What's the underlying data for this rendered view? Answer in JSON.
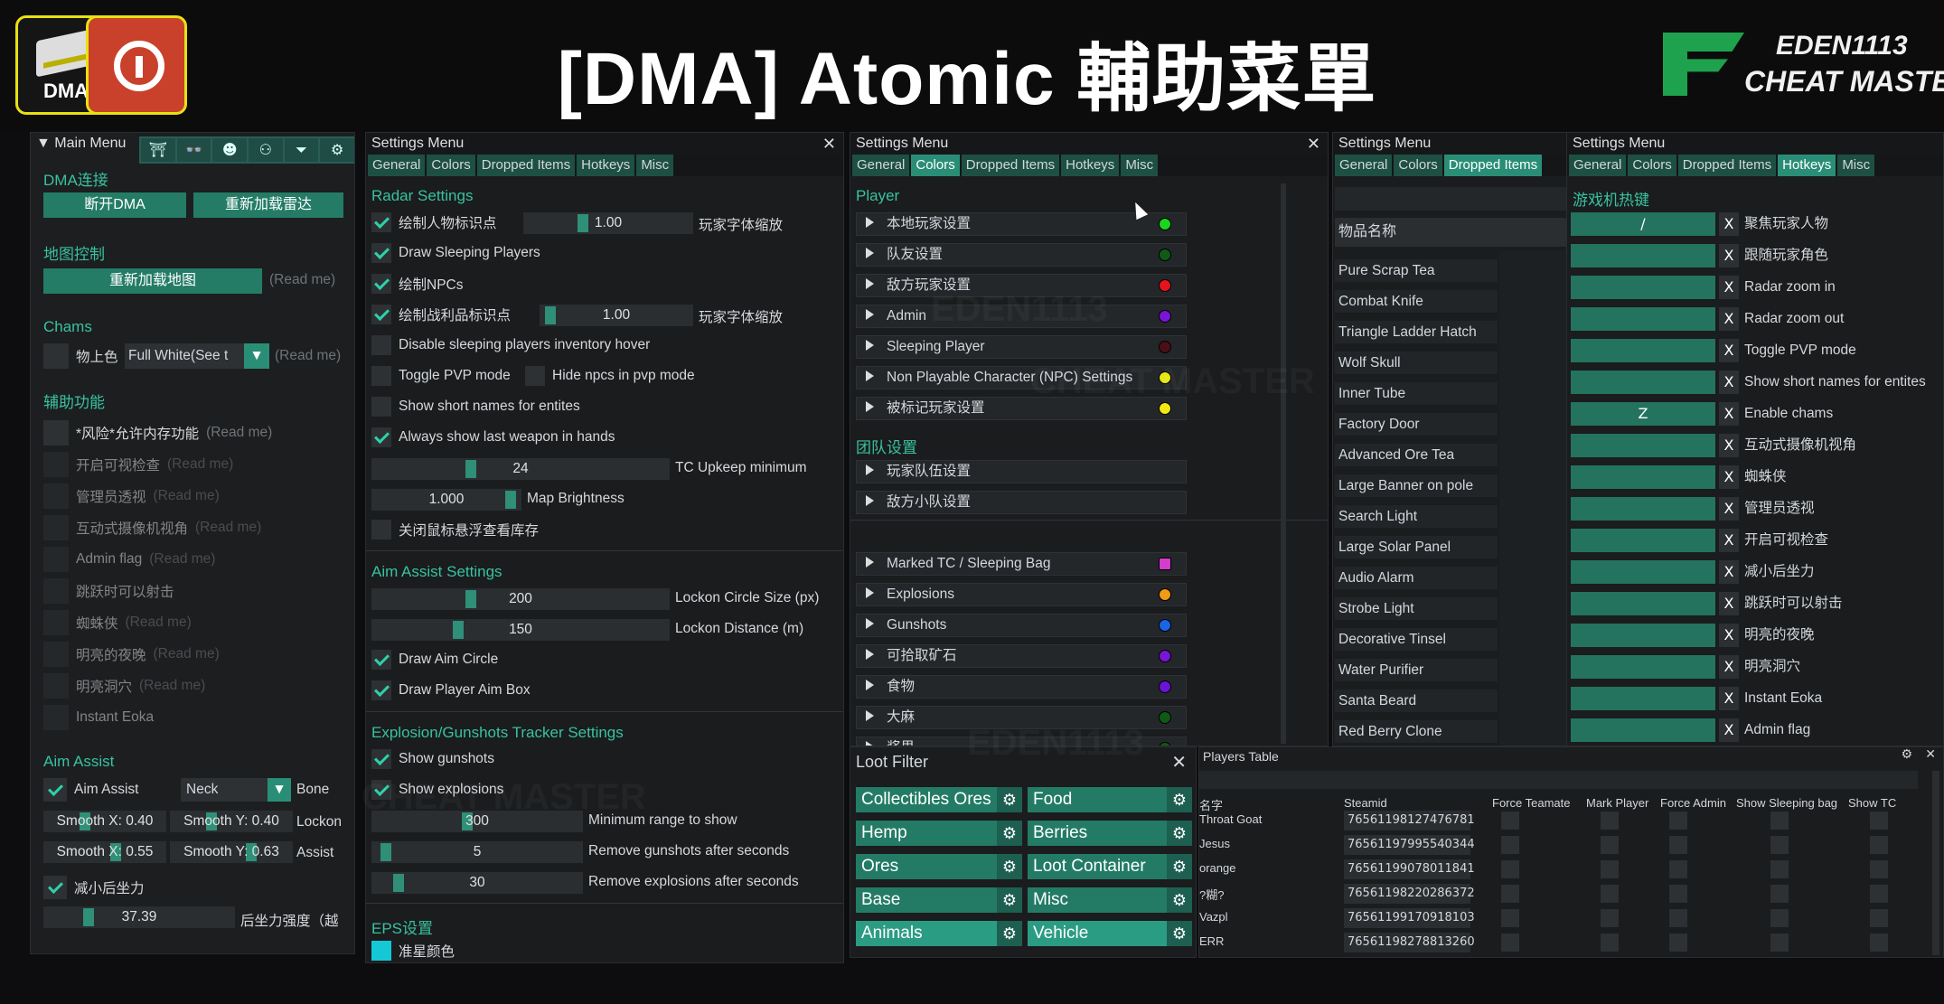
{
  "header": {
    "title": "[DMA] Atomic 輔助菜單",
    "logo_dma_label": "DMA",
    "brand_line1": "EDEN1113",
    "brand_line2": "CHEAT MASTER",
    "accent": "#e8e014",
    "brand_green": "#1ea24d"
  },
  "main_menu": {
    "title": "▼ Main Menu",
    "toolbar_icons": [
      "bridge-icon",
      "glasses-icon",
      "mask-icon",
      "group-icon",
      "filter-icon",
      "settings-icon"
    ],
    "dma_section": "DMA连接",
    "btn_disconnect": "断开DMA",
    "btn_reload_radar": "重新加载雷达",
    "map_section": "地图控制",
    "btn_reload_map": "重新加载地图",
    "read_me": "(Read me)",
    "chams_section": "Chams",
    "chams_label": "物上色",
    "chams_select": "Full White(See t",
    "aux_section": "辅助功能",
    "aux_items": [
      {
        "label": "*风险*允许内存功能",
        "note": "(Read me)",
        "enabled": true
      },
      {
        "label": "开启可视检查",
        "note": "(Read me)",
        "enabled": false
      },
      {
        "label": "管理员透视",
        "note": "(Read me)",
        "enabled": false
      },
      {
        "label": "互动式摄像机视角",
        "note": "(Read me)",
        "enabled": false
      },
      {
        "label": "Admin flag",
        "note": "(Read me)",
        "enabled": false
      },
      {
        "label": "跳跃时可以射击",
        "note": "",
        "enabled": false
      },
      {
        "label": "蜘蛛侠",
        "note": "(Read me)",
        "enabled": false
      },
      {
        "label": "明亮的夜晚",
        "note": "(Read me)",
        "enabled": false
      },
      {
        "label": "明亮洞穴",
        "note": "(Read me)",
        "enabled": false
      },
      {
        "label": "Instant Eoka",
        "note": "",
        "enabled": false
      }
    ],
    "aim_section": "Aim Assist",
    "aim_assist_label": "Aim Assist",
    "bone_select": "Neck",
    "bone_label": "Bone",
    "smooth_x1": "Smooth X: 0.40",
    "smooth_y1": "Smooth Y: 0.40",
    "lockon_label": "Lockon",
    "smooth_x2": "Smooth X: 0.55",
    "smooth_y2": "Smooth Y: 0.63",
    "assist_label": "Assist",
    "recoil_label": "减小后坐力",
    "recoil_value": "37.39",
    "recoil_strength_label": "后坐力强度（越"
  },
  "settings_radar": {
    "title": "Settings Menu",
    "tabs": [
      "General",
      "Colors",
      "Dropped Items",
      "Hotkeys",
      "Misc"
    ],
    "radar_section": "Radar Settings",
    "r1_label": "绘制人物标识点",
    "r1_value": "1.00",
    "r1_suffix": "玩家字体缩放",
    "draw_sleeping": "Draw Sleeping Players",
    "draw_npcs": "绘制NPCs",
    "r4_label": "绘制战利品标识点",
    "r4_value": "1.00",
    "r4_suffix": "玩家字体缩放",
    "disable_sleeping": "Disable sleeping players inventory hover",
    "toggle_pvp": "Toggle PVP mode",
    "hide_npcs": "Hide npcs in pvp mode",
    "short_names": "Show short names for entites",
    "last_weapon": "Always show last weapon in hands",
    "tc_value": "24",
    "tc_label": "TC Upkeep minimum",
    "map_value": "1.000",
    "map_label": "Map Brightness",
    "hover_label": "关闭鼠标悬浮查看库存",
    "aim_section": "Aim Assist Settings",
    "lockon_size_value": "200",
    "lockon_size_label": "Lockon Circle Size (px)",
    "lockon_dist_value": "150",
    "lockon_dist_label": "Lockon Distance (m)",
    "draw_aim_circle": "Draw Aim Circle",
    "draw_aim_box": "Draw Player Aim Box",
    "explosion_section": "Explosion/Gunshots Tracker Settings",
    "show_gunshots": "Show gunshots",
    "show_explosions": "Show explosions",
    "min_range_value": "300",
    "min_range_label": "Minimum range to show",
    "remove_gun_value": "5",
    "remove_gun_label": "Remove gunshots after seconds",
    "remove_exp_value": "30",
    "remove_exp_label": "Remove explosions after seconds",
    "eps_section": "EPS设置",
    "crosshair_color": "准星颜色"
  },
  "settings_colors": {
    "title": "Settings Menu",
    "tabs": [
      "General",
      "Colors",
      "Dropped Items",
      "Hotkeys",
      "Misc"
    ],
    "player_section": "Player",
    "player_rows": [
      {
        "label": "本地玩家设置",
        "color": "#19d61c"
      },
      {
        "label": "队友设置",
        "color": "#0f5a14"
      },
      {
        "label": "敌方玩家设置",
        "color": "#e3141e"
      },
      {
        "label": "Admin",
        "color": "#7a14d6"
      },
      {
        "label": "Sleeping Player",
        "color": "#4a0f16"
      },
      {
        "label": "Non Playable Character (NPC) Settings",
        "color": "#e6e614"
      },
      {
        "label": "被标记玩家设置",
        "color": "#f2e614"
      }
    ],
    "team_section": "团队设置",
    "team_rows": [
      "玩家队伍设置",
      "敌方小队设置"
    ],
    "misc_rows": [
      {
        "label": "Marked TC / Sleeping Bag",
        "color": "#d63ccc"
      },
      {
        "label": "Explosions",
        "color": "#f29a14"
      },
      {
        "label": "Gunshots",
        "color": "#1a64e6"
      },
      {
        "label": "可拾取矿石",
        "color": "#7a14d6"
      },
      {
        "label": "食物",
        "color": "#6a14d6"
      },
      {
        "label": "大麻",
        "color": "#0f5a14"
      },
      {
        "label": "浆果",
        "color": "#0f5a14"
      }
    ]
  },
  "settings_items": {
    "title": "Settings Menu",
    "tabs": [
      "General",
      "Colors",
      "Dropped Items"
    ],
    "header": "物品名称",
    "items": [
      "Pure Scrap Tea",
      "Combat Knife",
      "Triangle Ladder Hatch",
      "Wolf Skull",
      "Inner Tube",
      "Factory Door",
      "Advanced Ore Tea",
      "Large Banner on pole",
      "Search Light",
      "Large Solar Panel",
      "Audio Alarm",
      "Strobe Light",
      "Decorative Tinsel",
      "Water Purifier",
      "Santa Beard",
      "Red Berry Clone"
    ]
  },
  "settings_hotkeys": {
    "title": "Settings Menu",
    "tabs": [
      "General",
      "Colors",
      "Dropped Items",
      "Hotkeys",
      "Misc"
    ],
    "section": "游戏机热键",
    "rows": [
      {
        "key": "/",
        "label": "聚焦玩家人物"
      },
      {
        "key": "",
        "label": "跟随玩家角色"
      },
      {
        "key": "",
        "label": "Radar zoom in"
      },
      {
        "key": "",
        "label": "Radar zoom out"
      },
      {
        "key": "",
        "label": "Toggle PVP mode"
      },
      {
        "key": "",
        "label": "Show short names for entites"
      },
      {
        "key": "Z",
        "label": "Enable chams"
      },
      {
        "key": "",
        "label": "互动式摄像机视角"
      },
      {
        "key": "",
        "label": "蜘蛛侠"
      },
      {
        "key": "",
        "label": "管理员透视"
      },
      {
        "key": "",
        "label": "开启可视检查"
      },
      {
        "key": "",
        "label": "减小后坐力"
      },
      {
        "key": "",
        "label": "跳跃时可以射击"
      },
      {
        "key": "",
        "label": "明亮的夜晚"
      },
      {
        "key": "",
        "label": "明亮洞穴"
      },
      {
        "key": "",
        "label": "Instant Eoka"
      },
      {
        "key": "",
        "label": "Admin flag"
      }
    ],
    "clear_label": "X"
  },
  "loot_filter": {
    "title": "Loot Filter",
    "items": [
      {
        "label": "Collectibles Ores",
        "active": false
      },
      {
        "label": "Food",
        "active": false
      },
      {
        "label": "Hemp",
        "active": false
      },
      {
        "label": "Berries",
        "active": false
      },
      {
        "label": "Ores",
        "active": false
      },
      {
        "label": "Loot Container",
        "active": false
      },
      {
        "label": "Base",
        "active": false
      },
      {
        "label": "Misc",
        "active": false
      },
      {
        "label": "Animals",
        "active": true
      },
      {
        "label": "Vehicle",
        "active": true
      }
    ]
  },
  "players_table": {
    "title": "Players Table",
    "columns": [
      "名字",
      "Steamid",
      "Force Teamate",
      "Mark Player",
      "Force Admin",
      "Show Sleeping bag",
      "Show TC"
    ],
    "rows": [
      {
        "name": "Throat Goat",
        "steamid": "76561198127476781"
      },
      {
        "name": "Jesus",
        "steamid": "76561197995540344"
      },
      {
        "name": "orange",
        "steamid": "76561199078011841"
      },
      {
        "name": "?糊?",
        "steamid": "76561198220286372"
      },
      {
        "name": "Vazpl",
        "steamid": "76561199170918103"
      },
      {
        "name": "ERR",
        "steamid": "76561198278813260"
      }
    ]
  }
}
